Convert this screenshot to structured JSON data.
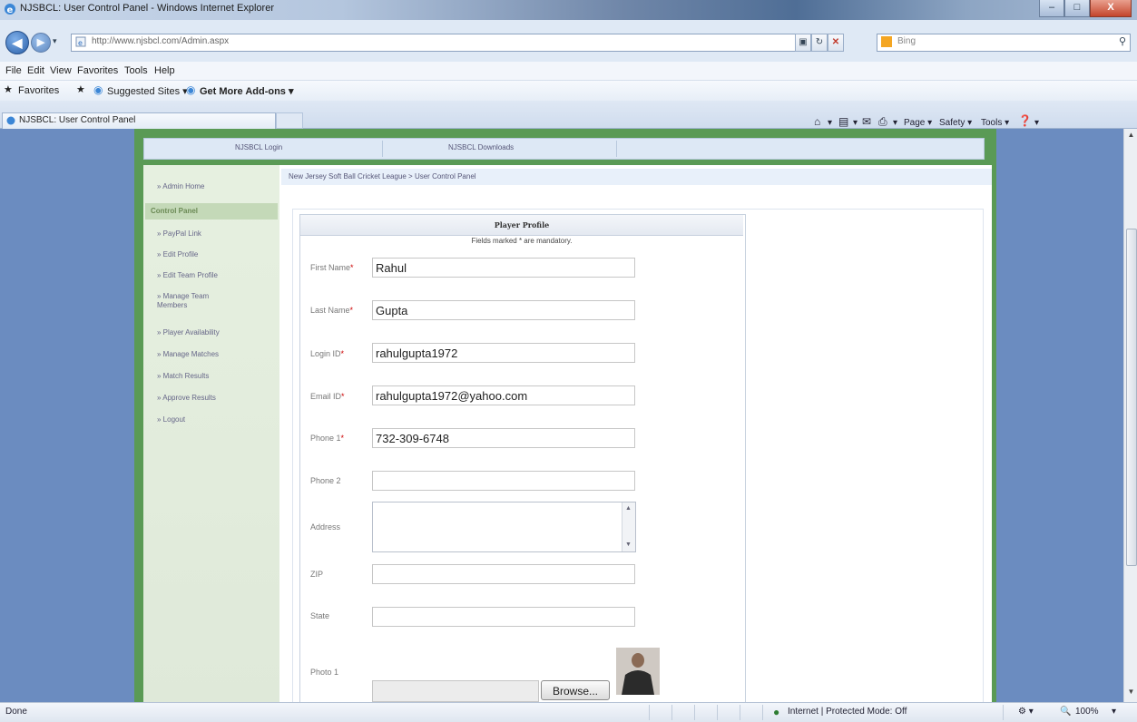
{
  "window": {
    "title": "NJSBCL: User Control Panel - Windows Internet Explorer",
    "controls": {
      "minimize": "–",
      "maximize": "□",
      "close": "X"
    }
  },
  "address_bar": {
    "url": "http://www.njsbcl.com/Admin.aspx",
    "search_placeholder": "Bing"
  },
  "menu": [
    "File",
    "Edit",
    "View",
    "Favorites",
    "Tools",
    "Help"
  ],
  "favorites_bar": {
    "favorites_label": "Favorites",
    "items": [
      "Suggested Sites ▾",
      "Get More Add-ons ▾"
    ]
  },
  "tabs": [
    {
      "label": "NJSBCL: User Control Panel"
    }
  ],
  "command_bar": [
    "Page ▾",
    "Safety ▾",
    "Tools ▾"
  ],
  "top_nav": [
    "NJSBCL Login",
    "NJSBCL Downloads"
  ],
  "breadcrumb": "New Jersey Soft Ball Cricket League > User Control Panel",
  "sidebar": {
    "items": [
      "» Admin Home",
      "Control Panel",
      "» PayPal Link",
      "» Edit Profile",
      "» Edit Team Profile",
      "» Manage Team Members",
      "» Player Availability",
      "» Manage Matches",
      "» Match Results",
      "» Approve Results",
      "» Logout"
    ],
    "active_index": 1
  },
  "form": {
    "title": "Player Profile",
    "subtitle": "Fields marked * are mandatory.",
    "fields": {
      "first_name": {
        "label": "First Name",
        "value": "Rahul",
        "required": "*"
      },
      "last_name": {
        "label": "Last Name",
        "value": "Gupta",
        "required": "*"
      },
      "login_id": {
        "label": "Login ID",
        "value": "rahulgupta1972",
        "required": "*"
      },
      "email_id": {
        "label": "Email ID",
        "value": "rahulgupta1972@yahoo.com",
        "required": "*"
      },
      "phone1": {
        "label": "Phone 1",
        "value": "732-309-6748",
        "required": "*"
      },
      "phone2": {
        "label": "Phone 2",
        "value": ""
      },
      "address": {
        "label": "Address",
        "value": ""
      },
      "zip": {
        "label": "ZIP",
        "value": ""
      },
      "state": {
        "label": "State",
        "value": ""
      },
      "photo1": {
        "label": "Photo 1",
        "browse_label": "Browse..."
      }
    }
  },
  "status_bar": {
    "left": "Done",
    "zone": "Internet | Protected Mode: Off",
    "zoom": "100%"
  }
}
